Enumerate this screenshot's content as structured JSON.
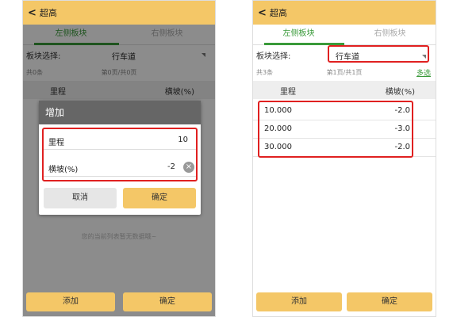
{
  "left": {
    "topbar": {
      "back": "<",
      "title": "超高"
    },
    "tabs": [
      "左侧板块",
      "右侧板块"
    ],
    "select": {
      "label": "板块选择:",
      "value": "行车道"
    },
    "pageinfo": {
      "count": "共0条",
      "pages": "第0页/共0页"
    },
    "table": {
      "col1": "里程",
      "col2": "横坡(%)"
    },
    "dialog": {
      "title": "增加",
      "field1": {
        "label": "里程",
        "value": "10"
      },
      "field2": {
        "label": "横坡(%)",
        "value": "-2"
      },
      "clear_icon": "×",
      "cancel": "取消",
      "ok": "确定"
    },
    "empty_hint": "您的当前列表暂无数据哦~",
    "buttons": {
      "add": "添加",
      "ok": "确定"
    }
  },
  "right": {
    "topbar": {
      "back": "<",
      "title": "超高"
    },
    "tabs": [
      "左侧板块",
      "右侧板块"
    ],
    "select": {
      "label": "板块选择:",
      "value": "行车道"
    },
    "pageinfo": {
      "count": "共3条",
      "pages": "第1页/共1页",
      "multi": "多选"
    },
    "table": {
      "col1": "里程",
      "col2": "横坡(%)",
      "rows": [
        {
          "mileage": "10.000",
          "slope": "-2.0"
        },
        {
          "mileage": "20.000",
          "slope": "-3.0"
        },
        {
          "mileage": "30.000",
          "slope": "-2.0"
        }
      ]
    },
    "buttons": {
      "add": "添加",
      "ok": "确定"
    }
  },
  "colors": {
    "accent": "#f4c767",
    "tab_active": "#3a9a3a",
    "highlight": "#e02020"
  }
}
